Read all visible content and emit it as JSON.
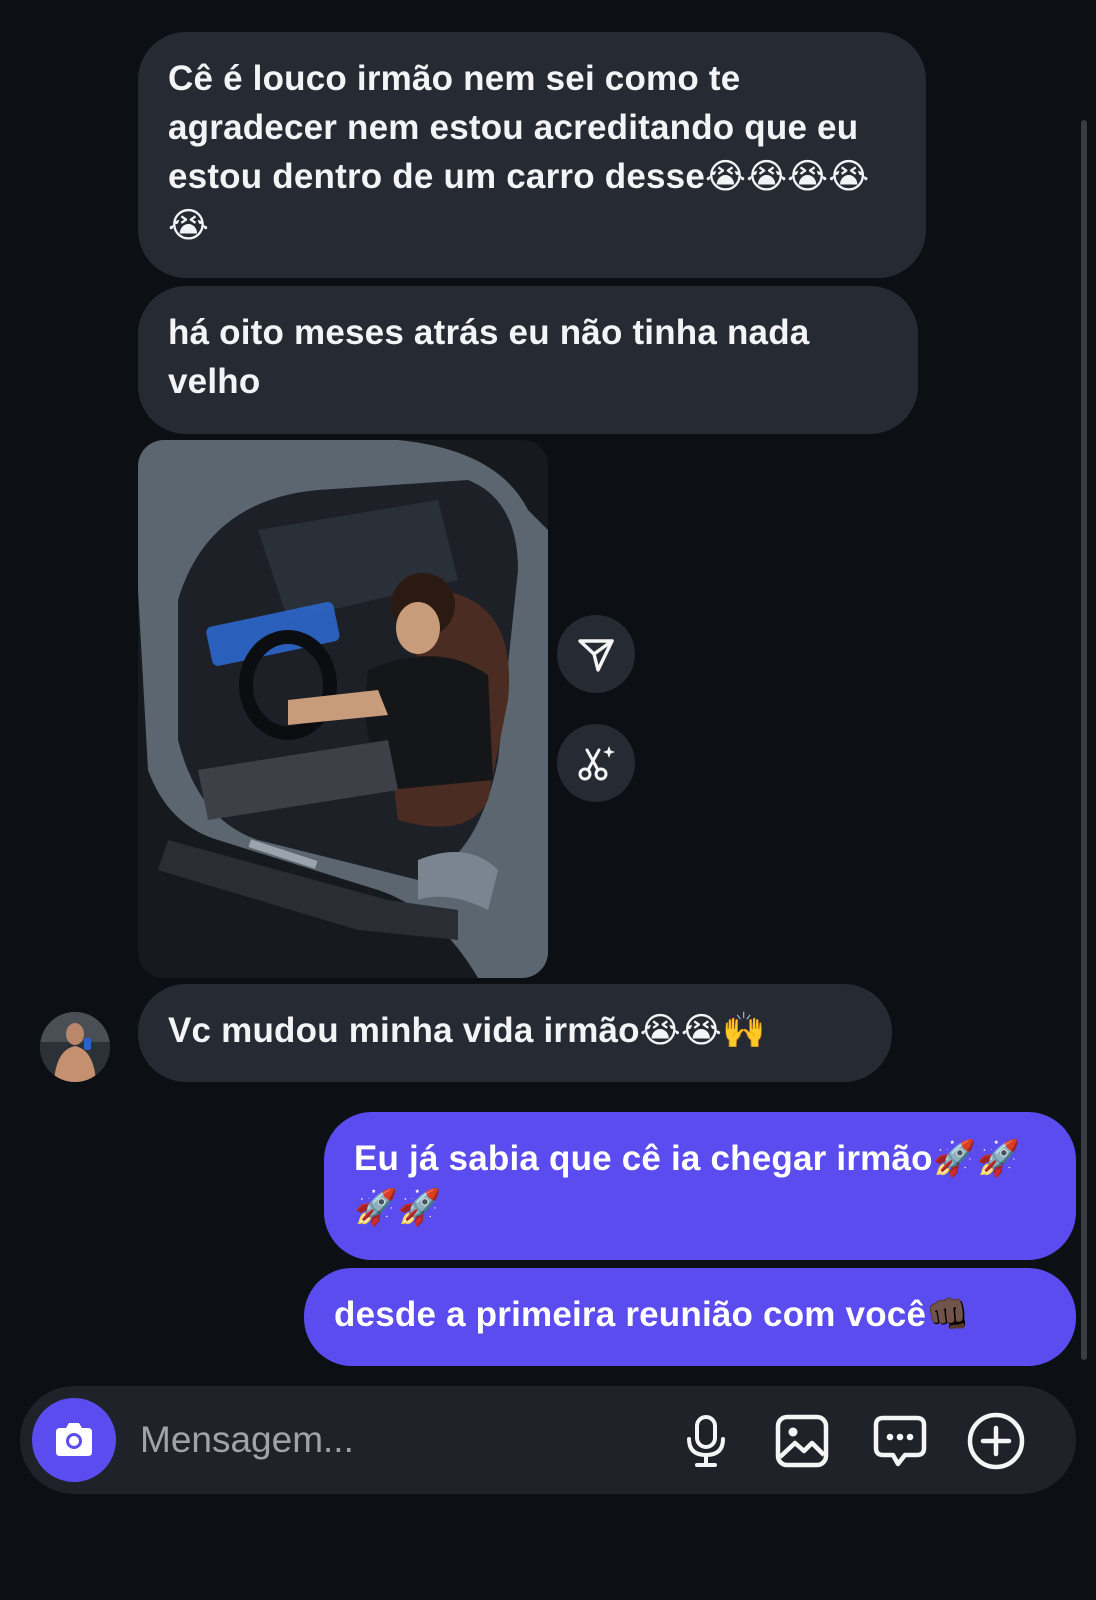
{
  "messages": {
    "incoming_1": "Cê é louco irmão nem sei como te agradecer nem estou acreditando que eu estou dentro de um carro desse😭😭😭😭😭",
    "incoming_2": "há oito meses atrás eu não tinha nada velho",
    "incoming_3": "Vc mudou minha vida irmão😭😭🙌",
    "outgoing_1": "Eu já sabia que cê ia chegar irmão🚀🚀🚀🚀",
    "outgoing_2": "desde a primeira reunião com você👊🏿"
  },
  "photo": {
    "icon": "photo-car-interior"
  },
  "actions": {
    "share_icon": "share-icon",
    "remix_icon": "sparkle-scissors-icon"
  },
  "composer": {
    "placeholder": "Mensagem...",
    "camera_icon": "camera-icon",
    "mic_icon": "microphone-icon",
    "gallery_icon": "image-icon",
    "sticker_icon": "chat-bubble-icon",
    "plus_icon": "plus-circle-icon"
  },
  "colors": {
    "background": "#0c1014",
    "incoming_bubble": "#262a33",
    "outgoing_bubble": "#5b4cf0",
    "accent": "#5b4cf0"
  }
}
